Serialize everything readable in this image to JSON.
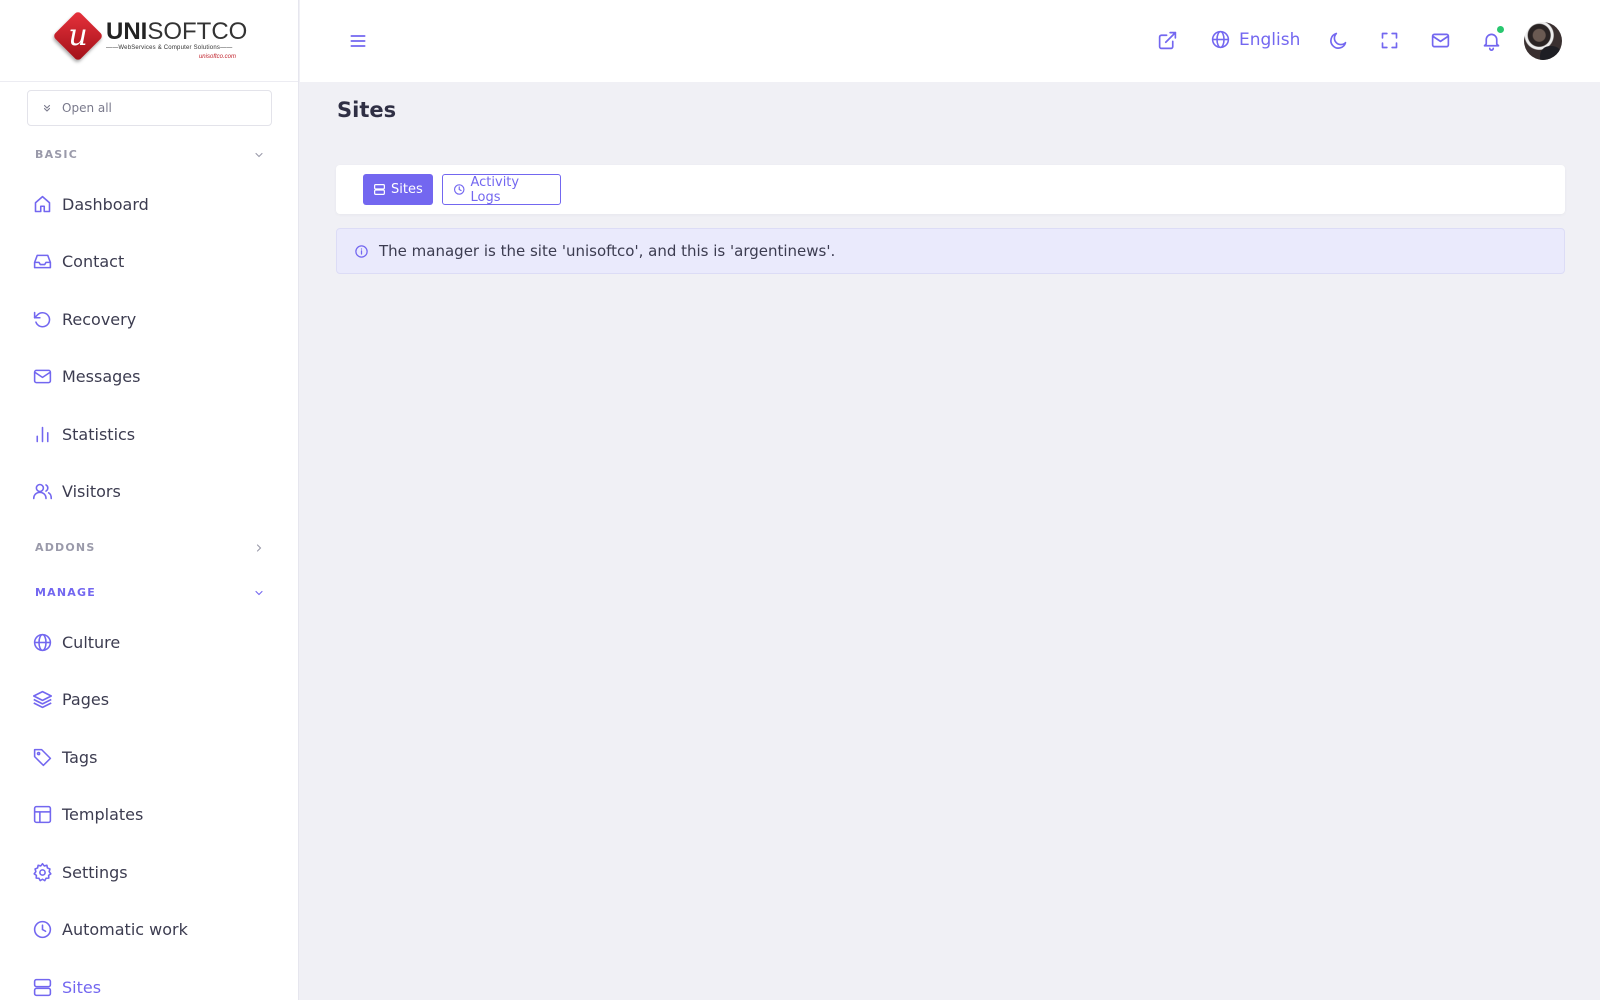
{
  "brand": {
    "logo_letter": "u",
    "logo_bold": "UNI",
    "logo_light": "SOFTCO",
    "logo_tagline": "——WebServices & Computer Solutions——",
    "logo_site": "unisoftco.com"
  },
  "sidebar": {
    "open_all_label": "Open all",
    "sections": {
      "basic": "BASIC",
      "addons": "ADDONS",
      "manage": "MANAGE"
    },
    "basic_items": [
      {
        "label": "Dashboard",
        "icon": "home-icon"
      },
      {
        "label": "Contact",
        "icon": "inbox-icon"
      },
      {
        "label": "Recovery",
        "icon": "rotate-ccw-icon"
      },
      {
        "label": "Messages",
        "icon": "mail-icon"
      },
      {
        "label": "Statistics",
        "icon": "bar-chart-icon"
      },
      {
        "label": "Visitors",
        "icon": "users-icon"
      }
    ],
    "manage_items": [
      {
        "label": "Culture",
        "icon": "globe-icon"
      },
      {
        "label": "Pages",
        "icon": "layers-icon"
      },
      {
        "label": "Tags",
        "icon": "tag-icon"
      },
      {
        "label": "Templates",
        "icon": "layout-icon"
      },
      {
        "label": "Settings",
        "icon": "gear-icon"
      },
      {
        "label": "Automatic work",
        "icon": "clock-icon"
      },
      {
        "label": "Sites",
        "icon": "server-icon",
        "active": true
      }
    ]
  },
  "header": {
    "language": "English"
  },
  "main": {
    "page_title": "Sites",
    "tabs": [
      {
        "label": "Sites",
        "active": true
      },
      {
        "label": "Activity Logs",
        "active": false
      }
    ],
    "alert_text": "The manager is the site 'unisoftco', and this is 'argentinews'."
  },
  "colors": {
    "accent": "#7367f0",
    "online": "#28c76f",
    "background": "#f0f0f5"
  }
}
